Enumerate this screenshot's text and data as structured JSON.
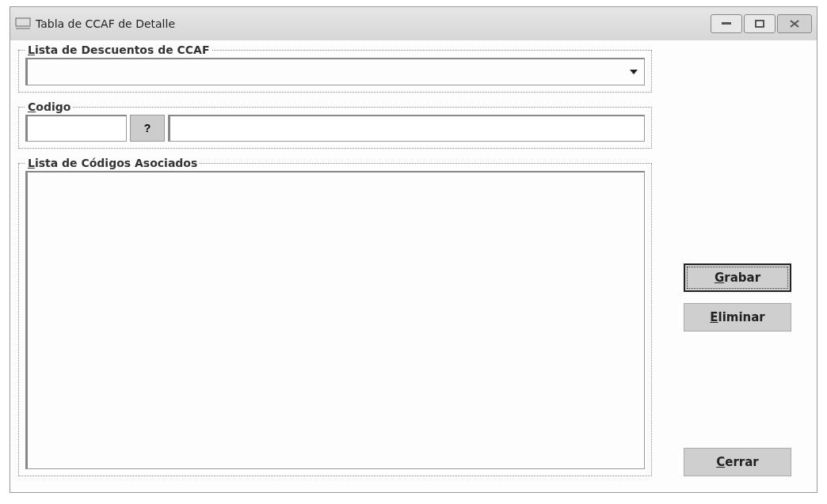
{
  "window": {
    "title": "Tabla de CCAF de Detalle"
  },
  "groups": [
    {
      "kind": "combo",
      "label": "Lista de Descuentos de CCAF",
      "mnemonic": true
    },
    {
      "kind": "lookup",
      "label": "Codigo",
      "mnemonic": true,
      "lookup_button": "?"
    },
    {
      "kind": "list",
      "label": "Lista de Códigos Asociados",
      "mnemonic": true
    }
  ],
  "buttons": [
    {
      "label": "Grabar",
      "mnemonic": true,
      "default": true
    },
    {
      "label": "Eliminar",
      "mnemonic": true,
      "default": false
    },
    {
      "label": "Cerrar",
      "mnemonic": true,
      "default": false
    }
  ]
}
